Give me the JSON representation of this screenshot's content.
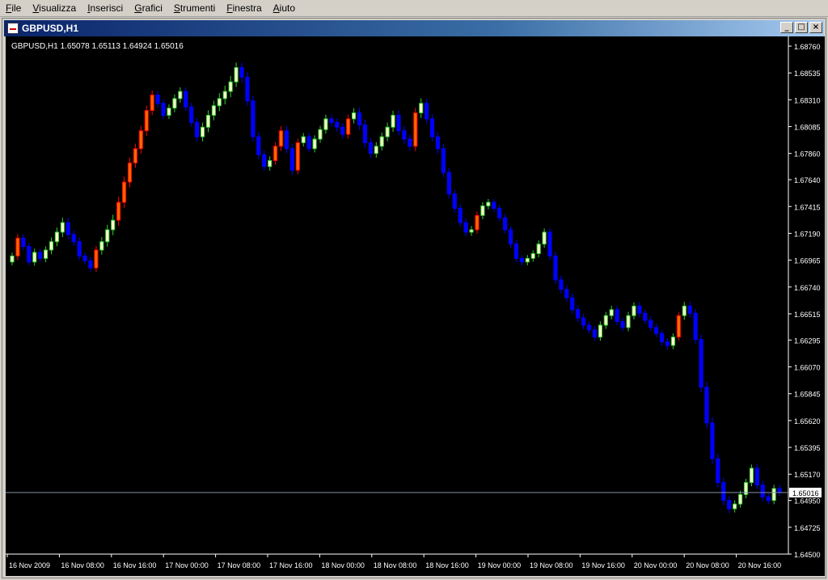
{
  "menu": [
    "File",
    "Visualizza",
    "Inserisci",
    "Grafici",
    "Strumenti",
    "Finestra",
    "Aiuto"
  ],
  "window": {
    "title": "GBPUSD,H1"
  },
  "chart_data": {
    "type": "candlestick",
    "symbol_info": "GBPUSD,H1  1.65078 1.65113 1.64924 1.65016",
    "price_levels": [
      "1.68760",
      "1.68535",
      "1.68310",
      "1.68085",
      "1.67860",
      "1.67640",
      "1.67415",
      "1.67190",
      "1.66965",
      "1.66740",
      "1.66515",
      "1.66295",
      "1.66070",
      "1.65845",
      "1.65620",
      "1.65395",
      "1.65170",
      "1.64950",
      "1.64725",
      "1.64500"
    ],
    "ylim": [
      1.645,
      1.6876
    ],
    "current_price": "1.65016",
    "current_price_value": 1.65016,
    "time_labels": [
      "16 Nov 2009",
      "16 Nov 08:00",
      "16 Nov 16:00",
      "17 Nov 00:00",
      "17 Nov 08:00",
      "17 Nov 16:00",
      "18 Nov 00:00",
      "18 Nov 08:00",
      "18 Nov 16:00",
      "19 Nov 00:00",
      "19 Nov 08:00",
      "19 Nov 16:00",
      "20 Nov 00:00",
      "20 Nov 08:00",
      "20 Nov 16:00"
    ],
    "colors": {
      "background": "#000000",
      "axis": "#ffffff",
      "bull": "#33cc33",
      "bull_body": "#ffffcc",
      "bear": "#0000ff",
      "up_bar": "#ff0000",
      "orange": "#ff6600",
      "price_line": "#7f8fa6"
    },
    "closes": [
      1.67,
      1.6715,
      1.6708,
      1.6695,
      1.6703,
      1.6698,
      1.6705,
      1.6712,
      1.672,
      1.6728,
      1.6718,
      1.6712,
      1.67,
      1.6696,
      1.669,
      1.6705,
      1.6712,
      1.6722,
      1.673,
      1.6745,
      1.6762,
      1.6778,
      1.679,
      1.6805,
      1.6822,
      1.6835,
      1.6828,
      1.6818,
      1.6824,
      1.6832,
      1.6838,
      1.6825,
      1.6812,
      1.68,
      1.6808,
      1.6818,
      1.6826,
      1.6832,
      1.6838,
      1.6846,
      1.6858,
      1.685,
      1.683,
      1.68,
      1.6785,
      1.6775,
      1.678,
      1.6792,
      1.6805,
      1.679,
      1.6772,
      1.6795,
      1.68,
      1.679,
      1.6798,
      1.6806,
      1.6815,
      1.6812,
      1.6808,
      1.6802,
      1.6815,
      1.682,
      1.681,
      1.6795,
      1.6786,
      1.6792,
      1.68,
      1.6808,
      1.6818,
      1.6805,
      1.6798,
      1.6792,
      1.682,
      1.6828,
      1.6815,
      1.68,
      1.679,
      1.677,
      1.6752,
      1.674,
      1.6728,
      1.672,
      1.6722,
      1.6734,
      1.6742,
      1.6745,
      1.674,
      1.6732,
      1.6722,
      1.671,
      1.6698,
      1.6695,
      1.6698,
      1.6702,
      1.671,
      1.672,
      1.67,
      1.668,
      1.6672,
      1.6665,
      1.6655,
      1.6648,
      1.6642,
      1.6638,
      1.6632,
      1.6642,
      1.665,
      1.6655,
      1.6645,
      1.664,
      1.665,
      1.6658,
      1.6652,
      1.6646,
      1.664,
      1.6635,
      1.6628,
      1.6625,
      1.6632,
      1.665,
      1.6658,
      1.6652,
      1.663,
      1.659,
      1.656,
      1.653,
      1.651,
      1.6495,
      1.6488,
      1.6492,
      1.65,
      1.651,
      1.6522,
      1.6508,
      1.6498,
      1.6495,
      1.6505,
      1.6502
    ],
    "ranges": [
      8,
      10,
      9,
      8,
      9,
      8,
      9,
      10,
      11,
      12,
      11,
      10,
      10,
      9,
      9,
      10,
      11,
      12,
      13,
      13,
      13,
      13,
      12,
      12,
      12,
      11,
      10,
      9,
      9,
      10,
      10,
      10,
      10,
      11,
      11,
      12,
      12,
      13,
      14,
      14,
      12,
      12,
      12,
      12,
      11,
      10,
      10,
      10,
      11,
      11,
      11,
      10,
      9,
      9,
      9,
      9,
      10,
      10,
      10,
      10,
      10,
      11,
      12,
      12,
      11,
      10,
      10,
      11,
      11,
      11,
      11,
      11,
      12,
      12,
      11,
      11,
      11,
      11,
      11,
      10,
      10,
      10,
      9,
      9,
      9,
      8,
      8,
      8,
      9,
      9,
      9,
      8,
      8,
      8,
      9,
      9,
      10,
      10,
      10,
      10,
      10,
      10,
      10,
      9,
      9,
      9,
      9,
      9,
      9,
      9,
      9,
      9,
      9,
      9,
      9,
      9,
      9,
      9,
      9,
      9,
      10,
      10,
      10,
      12,
      13,
      13,
      12,
      11,
      10,
      9,
      9,
      9,
      9,
      10,
      10,
      9,
      9,
      9,
      9,
      8
    ]
  }
}
